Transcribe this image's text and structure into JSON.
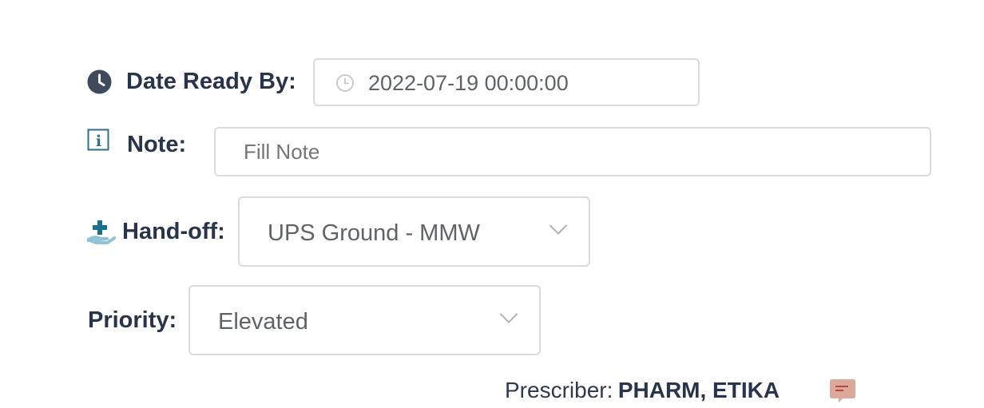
{
  "form": {
    "date_ready": {
      "icon": "clock-icon",
      "label": "Date Ready By:",
      "field_icon": "clock-outline-icon",
      "value": "2022-07-19 00:00:00"
    },
    "note": {
      "icon": "info-icon",
      "label": "Note:",
      "value": "",
      "placeholder": "Fill Note"
    },
    "handoff": {
      "icon": "hand-plus-icon",
      "label": "Hand-off:",
      "selected": "UPS Ground - MMW"
    },
    "priority": {
      "label": "Priority:",
      "selected": "Elevated"
    }
  },
  "prescriber": {
    "label": "Prescriber:",
    "name": "PHARM, ETIKA",
    "icon": "comment-icon"
  },
  "colors": {
    "label_text": "#27344b",
    "field_border": "#d9dbe0",
    "placeholder": "#b9bec7",
    "info_icon": "#2f6f8d",
    "handoff_cross": "#1b6f8a",
    "handoff_hand": "#8fc3d6",
    "comment_icon_bg": "#dba89a",
    "comment_icon_lines": "#b4483a"
  }
}
